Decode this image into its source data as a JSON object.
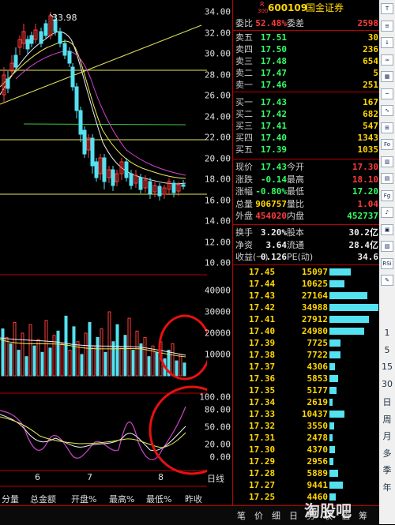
{
  "chart": {
    "high_marker": "33.98",
    "price_ticks": [
      "34.00",
      "32.00",
      "30.00",
      "28.00",
      "26.00",
      "24.00",
      "22.00",
      "20.00",
      "18.00",
      "16.00",
      "14.00",
      "12.00",
      "10.00"
    ],
    "volume_ticks": [
      "40000",
      "30000",
      "20000",
      "10000"
    ],
    "kdj_ticks": [
      "100.00",
      "80.00",
      "50.00",
      "20.00",
      "0.00"
    ],
    "date_labels": [
      "6",
      "7",
      "8"
    ],
    "period_label": "日线",
    "index_labels": [
      "分量",
      "总金额",
      "开盘%",
      "最高%",
      "最低%",
      "昨收"
    ],
    "volume_bars": [
      {
        "v": 22000,
        "up": false
      },
      {
        "v": 18000,
        "up": true
      },
      {
        "v": 15000,
        "up": false
      },
      {
        "v": 25000,
        "up": true
      },
      {
        "v": 12000,
        "up": false
      },
      {
        "v": 20000,
        "up": true
      },
      {
        "v": 9000,
        "up": false
      },
      {
        "v": 24000,
        "up": true
      },
      {
        "v": 14000,
        "up": false
      },
      {
        "v": 17000,
        "up": true
      },
      {
        "v": 11000,
        "up": false
      },
      {
        "v": 26000,
        "up": true
      },
      {
        "v": 13000,
        "up": false
      },
      {
        "v": 19000,
        "up": true
      },
      {
        "v": 21000,
        "up": false
      },
      {
        "v": 15000,
        "up": true
      },
      {
        "v": 28000,
        "up": false
      },
      {
        "v": 12000,
        "up": true
      },
      {
        "v": 23000,
        "up": false
      },
      {
        "v": 16000,
        "up": true
      },
      {
        "v": 10000,
        "up": false
      },
      {
        "v": 20000,
        "up": true
      },
      {
        "v": 25000,
        "up": false
      },
      {
        "v": 14000,
        "up": true
      },
      {
        "v": 18000,
        "up": false
      },
      {
        "v": 22000,
        "up": true
      },
      {
        "v": 11000,
        "up": false
      },
      {
        "v": 30000,
        "up": true
      },
      {
        "v": 16000,
        "up": false
      },
      {
        "v": 24000,
        "up": false
      },
      {
        "v": 13000,
        "up": true
      },
      {
        "v": 19000,
        "up": false
      },
      {
        "v": 27000,
        "up": true
      },
      {
        "v": 12000,
        "up": false
      },
      {
        "v": 21000,
        "up": true
      },
      {
        "v": 15000,
        "up": false
      },
      {
        "v": 18000,
        "up": true
      },
      {
        "v": 9000,
        "up": false
      },
      {
        "v": 14000,
        "up": true
      },
      {
        "v": 11000,
        "up": false
      },
      {
        "v": 16000,
        "up": true
      },
      {
        "v": 8000,
        "up": false
      },
      {
        "v": 12000,
        "up": false
      },
      {
        "v": 15000,
        "up": true
      },
      {
        "v": 7000,
        "up": false
      },
      {
        "v": 10000,
        "up": true
      },
      {
        "v": 6000,
        "up": false
      }
    ]
  },
  "quote": {
    "board_r": "R",
    "board_num": "300",
    "code": "600109",
    "name": "国金证券",
    "wei_bi_label": "委比",
    "wei_bi": "52.48%",
    "wei_cha_label": "委差",
    "wei_cha": "2598",
    "sells": [
      {
        "label": "卖五",
        "price": "17.51",
        "vol": "30"
      },
      {
        "label": "卖四",
        "price": "17.50",
        "vol": "236"
      },
      {
        "label": "卖三",
        "price": "17.48",
        "vol": "654"
      },
      {
        "label": "卖二",
        "price": "17.47",
        "vol": "5"
      },
      {
        "label": "卖一",
        "price": "17.46",
        "vol": "251"
      }
    ],
    "buys": [
      {
        "label": "买一",
        "price": "17.43",
        "vol": "167"
      },
      {
        "label": "买二",
        "price": "17.42",
        "vol": "682"
      },
      {
        "label": "买三",
        "price": "17.41",
        "vol": "547"
      },
      {
        "label": "买四",
        "price": "17.40",
        "vol": "1343"
      },
      {
        "label": "买五",
        "price": "17.39",
        "vol": "1035"
      }
    ],
    "stats": [
      {
        "l1": "现价",
        "v1": "17.43",
        "c1": "green",
        "l2": "今开",
        "v2": "17.30",
        "c2": "red"
      },
      {
        "l1": "涨跌",
        "v1": "-0.14",
        "c1": "green",
        "l2": "最高",
        "v2": "18.10",
        "c2": "red"
      },
      {
        "l1": "涨幅",
        "v1": "-0.80%",
        "c1": "green",
        "l2": "最低",
        "v2": "17.20",
        "c2": "green"
      },
      {
        "l1": "总量",
        "v1": "906757",
        "c1": "yellow",
        "l2": "量比",
        "v2": "1.04",
        "c2": "red"
      },
      {
        "l1": "外盘",
        "v1": "454020",
        "c1": "red",
        "l2": "内盘",
        "v2": "452737",
        "c2": "green"
      }
    ],
    "stats2": [
      {
        "l1": "换手",
        "v1": "3.20%",
        "l2": "股本",
        "v2": "30.2亿"
      },
      {
        "l1": "净资",
        "v1": "3.64",
        "l2": "流通",
        "v2": "28.4亿"
      },
      {
        "l1": "收益(一)",
        "v1": "0.126",
        "l2": "PE(动)",
        "v2": "34.6"
      }
    ],
    "depth": [
      {
        "price": "17.45",
        "vol": "15097",
        "ratio": 0.43
      },
      {
        "price": "17.44",
        "vol": "10625",
        "ratio": 0.3
      },
      {
        "price": "17.43",
        "vol": "27164",
        "ratio": 0.78
      },
      {
        "price": "17.42",
        "vol": "34988",
        "ratio": 1.0
      },
      {
        "price": "17.41",
        "vol": "27912",
        "ratio": 0.8
      },
      {
        "price": "17.40",
        "vol": "24980",
        "ratio": 0.71
      },
      {
        "price": "17.39",
        "vol": "7725",
        "ratio": 0.22
      },
      {
        "price": "17.38",
        "vol": "7722",
        "ratio": 0.22
      },
      {
        "price": "17.37",
        "vol": "4306",
        "ratio": 0.12
      },
      {
        "price": "17.36",
        "vol": "5853",
        "ratio": 0.17
      },
      {
        "price": "17.35",
        "vol": "5177",
        "ratio": 0.15
      },
      {
        "price": "17.34",
        "vol": "2619",
        "ratio": 0.07
      },
      {
        "price": "17.33",
        "vol": "10437",
        "ratio": 0.3
      },
      {
        "price": "17.32",
        "vol": "3550",
        "ratio": 0.1
      },
      {
        "price": "17.31",
        "vol": "2478",
        "ratio": 0.07
      },
      {
        "price": "17.30",
        "vol": "4370",
        "ratio": 0.12
      },
      {
        "price": "17.29",
        "vol": "2956",
        "ratio": 0.08
      },
      {
        "price": "17.28",
        "vol": "5889",
        "ratio": 0.17
      },
      {
        "price": "17.27",
        "vol": "9441",
        "ratio": 0.27
      },
      {
        "price": "17.25",
        "vol": "4460",
        "ratio": 0.13
      }
    ]
  },
  "toolbar": {
    "buttons": [
      "T",
      "≡",
      "↓",
      "≈",
      "▦",
      "~",
      "∿",
      "⊞",
      "Fo",
      "▥",
      "▤",
      "Fg",
      "♪",
      "▣",
      "▧",
      "RSi",
      "✎"
    ],
    "periods": [
      "1",
      "5",
      "15",
      "30",
      "日",
      "周",
      "月",
      "多",
      "季",
      "年"
    ]
  },
  "bottom_tabs": [
    "笔",
    "价",
    "细",
    "日",
    "势",
    "联",
    "值",
    "筹"
  ],
  "watermark": "淘股吧"
}
